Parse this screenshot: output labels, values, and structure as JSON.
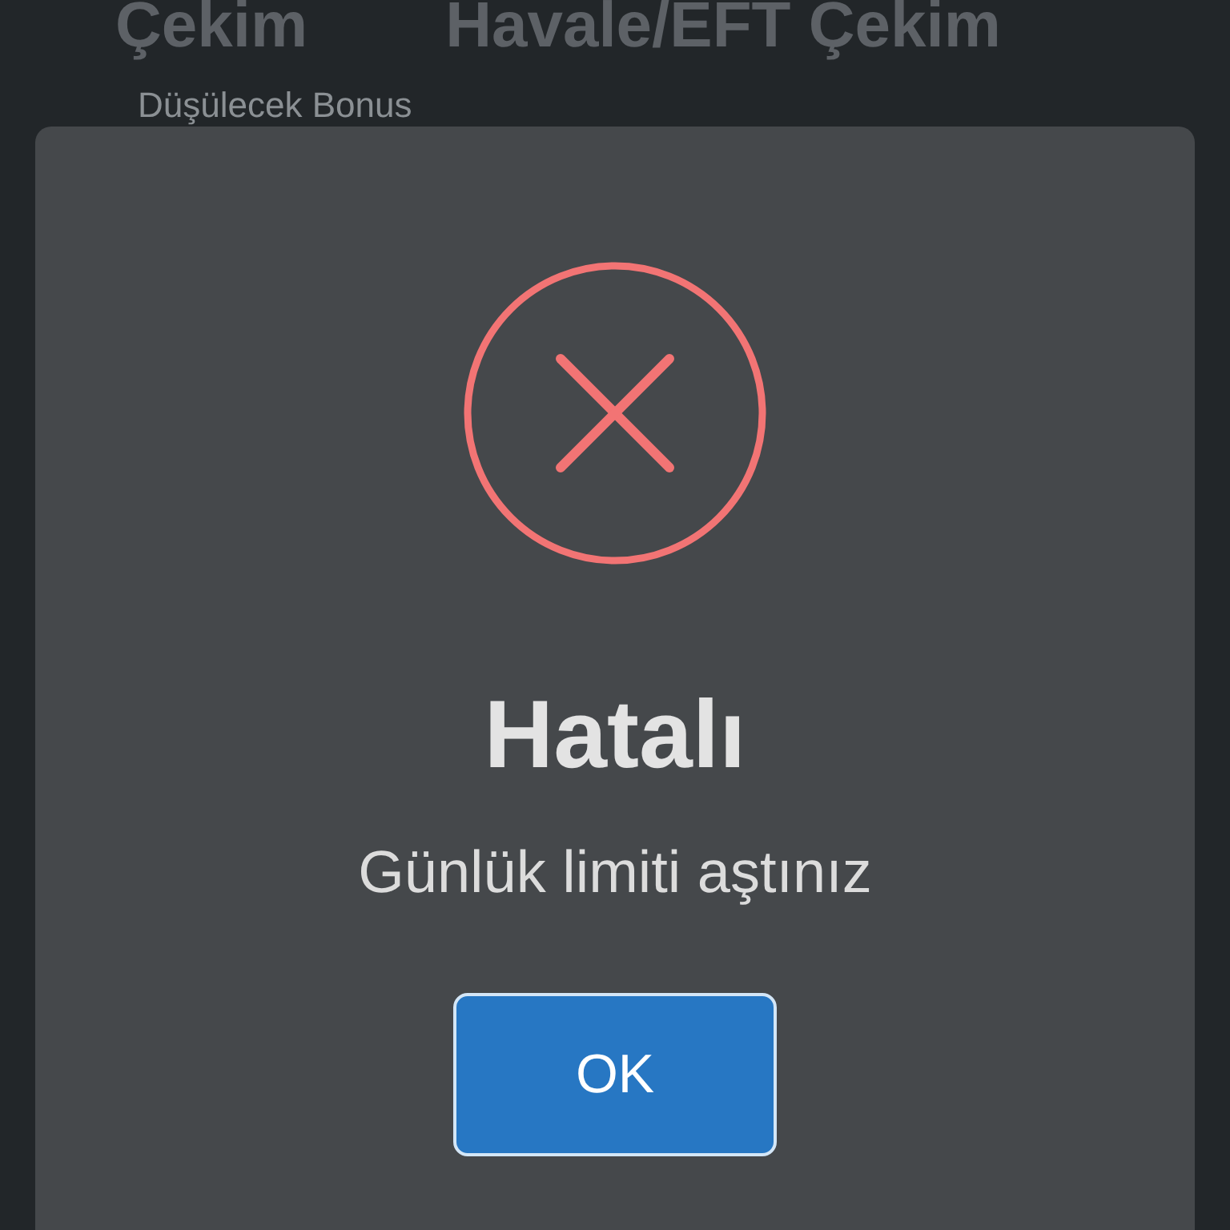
{
  "background": {
    "headings": [
      "Çekim",
      "Havale/EFT Çekim"
    ],
    "field_label": "Düşülecek Bonus"
  },
  "dialog": {
    "kind": "error",
    "title": "Hatalı",
    "message": "Günlük limiti aştınız",
    "buttons": [
      {
        "label": "OK",
        "focused": true
      }
    ]
  }
}
